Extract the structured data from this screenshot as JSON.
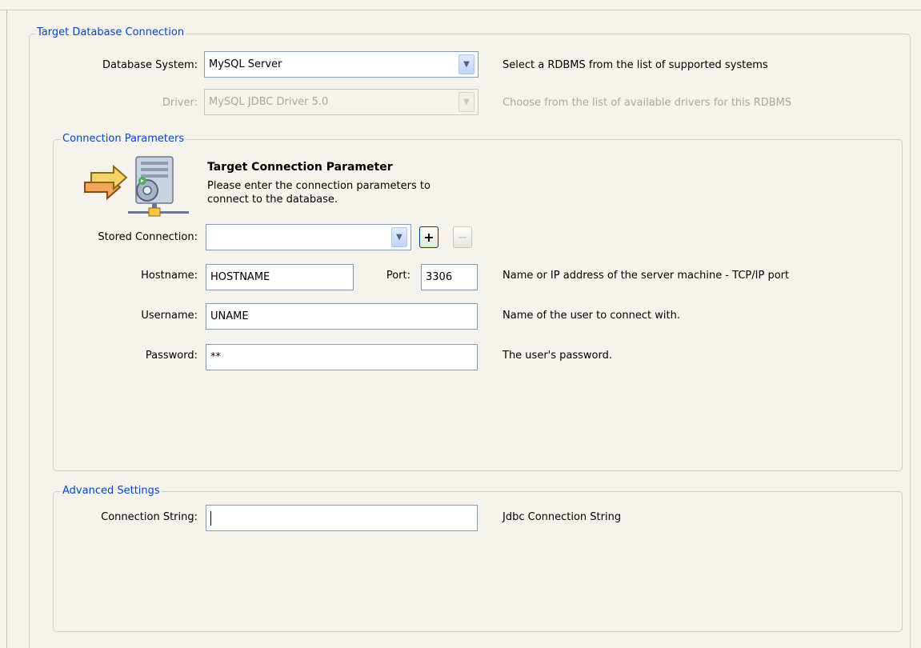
{
  "target_group": {
    "legend": "Target Database Connection",
    "database_system": {
      "label": "Database System:",
      "value": "MySQL Server",
      "hint": "Select a RDBMS from the list of supported systems"
    },
    "driver": {
      "label": "Driver:",
      "value": "MySQL JDBC Driver 5.0",
      "hint": "Choose from the list of available drivers for this RDBMS"
    }
  },
  "connection_params": {
    "legend": "Connection Parameters",
    "heading": "Target Connection Parameter",
    "description_line1": "Please enter the connection parameters to",
    "description_line2": "connect to the database.",
    "stored_connection": {
      "label": "Stored Connection:",
      "value": "",
      "add_label": "+",
      "remove_label": "−"
    },
    "hostname": {
      "label": "Hostname:",
      "value": "HOSTNAME"
    },
    "port": {
      "label": "Port:",
      "value": "3306"
    },
    "host_hint": "Name or IP address of the server machine - TCP/IP port",
    "username": {
      "label": "Username:",
      "value": "UNAME",
      "hint": "Name of the user to connect with."
    },
    "password": {
      "label": "Password:",
      "value": "**",
      "hint": "The user's password."
    }
  },
  "advanced": {
    "legend": "Advanced Settings",
    "connection_string": {
      "label": "Connection String:",
      "value": "",
      "hint": "Jdbc Connection String"
    }
  },
  "icons": {
    "connection": "server-connection-icon",
    "combo": "chevron-down-icon"
  },
  "colors": {
    "legend": "#0046d5",
    "background": "#f5f3ec",
    "field_border": "#7f9db9",
    "disabled_text": "#aca899"
  }
}
